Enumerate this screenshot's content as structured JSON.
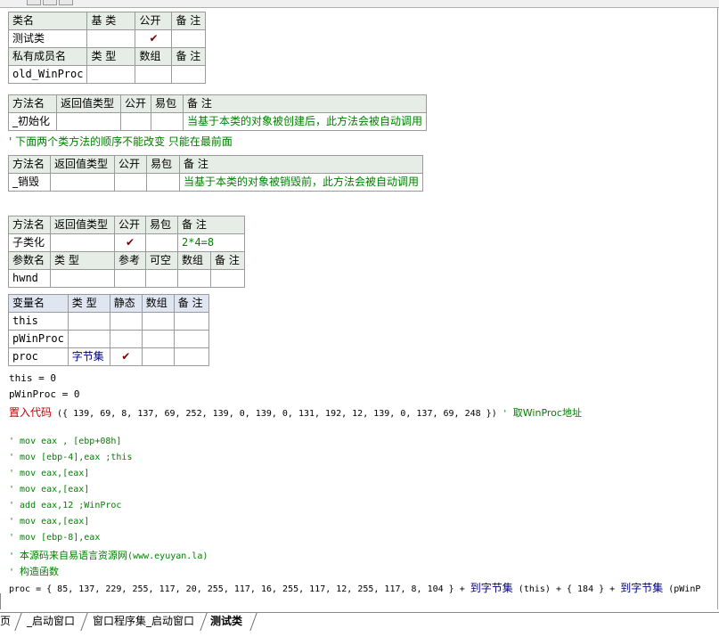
{
  "class_table": {
    "headers": [
      "类名",
      "基 类",
      "公开",
      "备 注"
    ],
    "row": {
      "name": "测试类",
      "base": "",
      "public": "✔",
      "note": ""
    },
    "member_headers": [
      "私有成员名",
      "类 型",
      "数组",
      "备 注"
    ],
    "member_row": {
      "name": "old_WinProc",
      "type": "",
      "array": "",
      "note": ""
    }
  },
  "method_init": {
    "headers": [
      "方法名",
      "返回值类型",
      "公开",
      "易包",
      "备 注"
    ],
    "row": {
      "name": "_初始化",
      "ret": "",
      "public": "",
      "easy": "",
      "note": "当基于本类的对象被创建后，此方法会被自动调用"
    }
  },
  "comment_order": "' 下面两个类方法的顺序不能改变 只能在最前面",
  "method_destroy": {
    "headers": [
      "方法名",
      "返回值类型",
      "公开",
      "易包",
      "备 注"
    ],
    "row": {
      "name": "_销毁",
      "ret": "",
      "public": "",
      "easy": "",
      "note": "当基于本类的对象被销毁前，此方法会被自动调用"
    }
  },
  "method_subclass": {
    "headers": [
      "方法名",
      "返回值类型",
      "公开",
      "易包",
      "备 注"
    ],
    "row": {
      "name": "子类化",
      "ret": "",
      "public": "✔",
      "easy": "",
      "note": "2*4=8"
    },
    "param_headers": [
      "参数名",
      "类 型",
      "参考",
      "可空",
      "数组",
      "备 注"
    ],
    "param_row": {
      "name": "hwnd",
      "type": "",
      "ref": "",
      "nullable": "",
      "array": "",
      "note": ""
    }
  },
  "locals": {
    "headers": [
      "变量名",
      "类 型",
      "静态",
      "数组",
      "备 注"
    ],
    "rows": [
      {
        "name": "this",
        "type": "",
        "static": "",
        "array": "",
        "note": ""
      },
      {
        "name": "pWinProc",
        "type": "",
        "static": "",
        "array": "",
        "note": ""
      },
      {
        "name": "proc",
        "type": "字节集",
        "static": "✔",
        "array": "",
        "note": ""
      }
    ]
  },
  "code": {
    "l1": "this = 0",
    "l2": "pWinProc = 0",
    "l3_cmd": "置入代码",
    "l3_args": " ({ 139, 69, 8, 137, 69, 252, 139, 0, 139, 0, 131, 192, 12, 139, 0, 137, 69, 248 }) ",
    "l3_comment_mark": " ' ",
    "l3_comment": "取WinProc地址",
    "c1": "' mov eax , [ebp+08h]",
    "c2": "' mov [ebp-4],eax ;this",
    "c3": "' mov eax,[eax]",
    "c4": "' mov eax,[eax]",
    "c5": "' add eax,12 ;WinProc",
    "c6": "' mov eax,[eax]",
    "c7": "' mov [ebp-8],eax",
    "c8_mark": "' ",
    "c8_text": "本源码来自易语言资源网",
    "c8_url": "(www.eyuyan.la)",
    "c9_mark": "' ",
    "c9_text": "构造函数",
    "last_a": "proc = { 85, 137, 229, 255, 117, 20, 255, 117, 16, 255, 117, 12, 255, 117, 8, 104 } + ",
    "last_fn1": "到字节集",
    "last_b": " (this) + { 184 } + ",
    "last_fn2": "到字节集",
    "last_c": " (pWinP"
  },
  "tabs": [
    "页",
    "_启动窗口",
    "窗口程序集_启动窗口",
    "测试类"
  ]
}
